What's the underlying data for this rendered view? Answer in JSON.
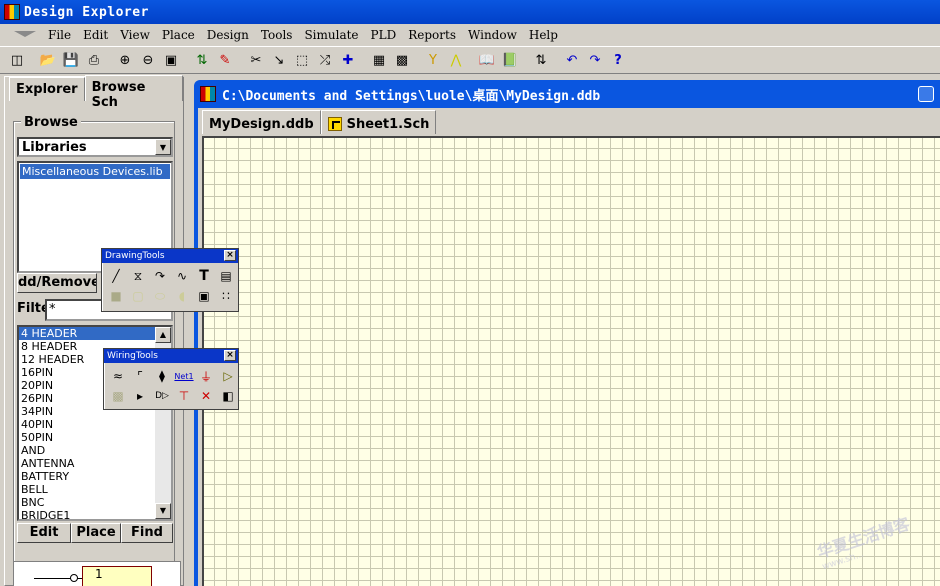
{
  "app": {
    "title": "Design Explorer"
  },
  "menu": [
    "File",
    "Edit",
    "View",
    "Place",
    "Design",
    "Tools",
    "Simulate",
    "PLD",
    "Reports",
    "Window",
    "Help"
  ],
  "toolbar_icons": [
    "design-manager-icon",
    "open-icon",
    "save-icon",
    "print-icon",
    "zoom-in-icon",
    "zoom-out-icon",
    "zoom-fit-icon",
    "hierarchy-icon",
    "pencil-icon",
    "cut-icon",
    "paste-icon",
    "select-icon",
    "move-icon",
    "cross-icon",
    "lib-icon",
    "place-part-icon",
    "probe-icon",
    "wire-icon",
    "book-icon",
    "book2-icon",
    "mask-icon",
    "undo-icon",
    "redo-icon",
    "help-icon"
  ],
  "left": {
    "tabs": [
      "Explorer",
      "Browse Sch"
    ],
    "browse_label": "Browse",
    "lib_select": "Libraries",
    "libraries": [
      "Miscellaneous Devices.lib"
    ],
    "add_remove": "dd/Remove",
    "filter_label": "Filte",
    "filter_value": "*",
    "components": [
      "4 HEADER",
      "8 HEADER",
      "12 HEADER",
      "16PIN",
      "20PIN",
      "26PIN",
      "34PIN",
      "40PIN",
      "50PIN",
      "AND",
      "ANTENNA",
      "BATTERY",
      "BELL",
      "BNC",
      "BRIDGE1"
    ],
    "buttons": {
      "edit": "Edit",
      "place": "Place",
      "find": "Find"
    },
    "preview_pin": "1"
  },
  "doc": {
    "title": "C:\\Documents and Settings\\luole\\桌面\\MyDesign.ddb",
    "tabs": [
      "MyDesign.ddb",
      "Sheet1.Sch"
    ]
  },
  "drawing_tools": {
    "title": "DrawingTools",
    "close": "×"
  },
  "wiring_tools": {
    "title": "WiringTools",
    "close": "×",
    "net_label": "Net1"
  },
  "watermark": {
    "line1": "华夏生活博客",
    "line2": "www.sh..."
  }
}
